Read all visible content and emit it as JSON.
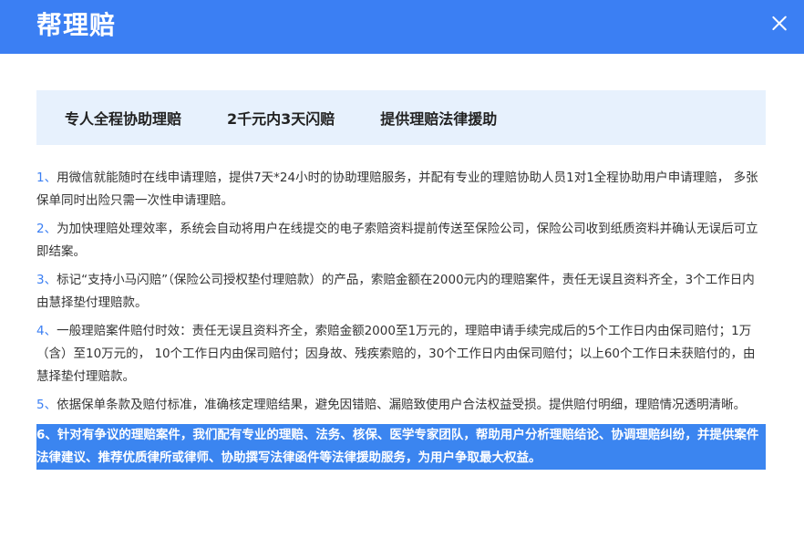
{
  "dialog": {
    "title": "帮理赔",
    "close_icon": "close-icon",
    "colors": {
      "header": "#3b7ff3",
      "feature_bar": "#e7f1fd",
      "highlight": "#3b85f0"
    }
  },
  "features": [
    "专人全程协助理赔",
    "2千元内3天闪赔",
    "提供理赔法律援助"
  ],
  "items": [
    {
      "num": "1、",
      "text": "用微信就能随时在线申请理赔，提供7天*24小时的协助理赔服务，并配有专业的理赔协助人员1对1全程协助用户申请理赔， 多张保单同时出险只需一次性申请理赔。"
    },
    {
      "num": "2、",
      "text": "为加快理赔处理效率，系统会自动将用户在线提交的电子索赔资料提前传送至保险公司，保险公司收到纸质资料并确认无误后可立即结案。"
    },
    {
      "num": "3、",
      "text": "标记“支持小马闪赔”（保险公司授权垫付理赔款）的产品，索赔金额在2000元内的理赔案件，责任无误且资料齐全，3个工作日内由慧择垫付理赔款。"
    },
    {
      "num": "4、",
      "text": "一般理赔案件赔付时效：责任无误且资料齐全，索赔金额2000至1万元的，理赔申请手续完成后的5个工作日内由保司赔付；1万（含）至10万元的， 10个工作日内由保司赔付；因身故、残疾索赔的，30个工作日内由保司赔付；以上60个工作日未获赔付的，由慧择垫付理赔款。"
    },
    {
      "num": "5、",
      "text": "依据保单条款及赔付标准，准确核定理赔结果，避免因错赔、漏赔致使用户合法权益受损。提供赔付明细，理赔情况透明清晰。"
    },
    {
      "num": "6、",
      "text": "针对有争议的理赔案件，我们配有专业的理赔、法务、核保、医学专家团队，帮助用户分析理赔结论、协调理赔纠纷，并提供案件法律建议、推荐优质律所或律师、协助撰写法律函件等法律援助服务，为用户争取最大权益。"
    }
  ]
}
